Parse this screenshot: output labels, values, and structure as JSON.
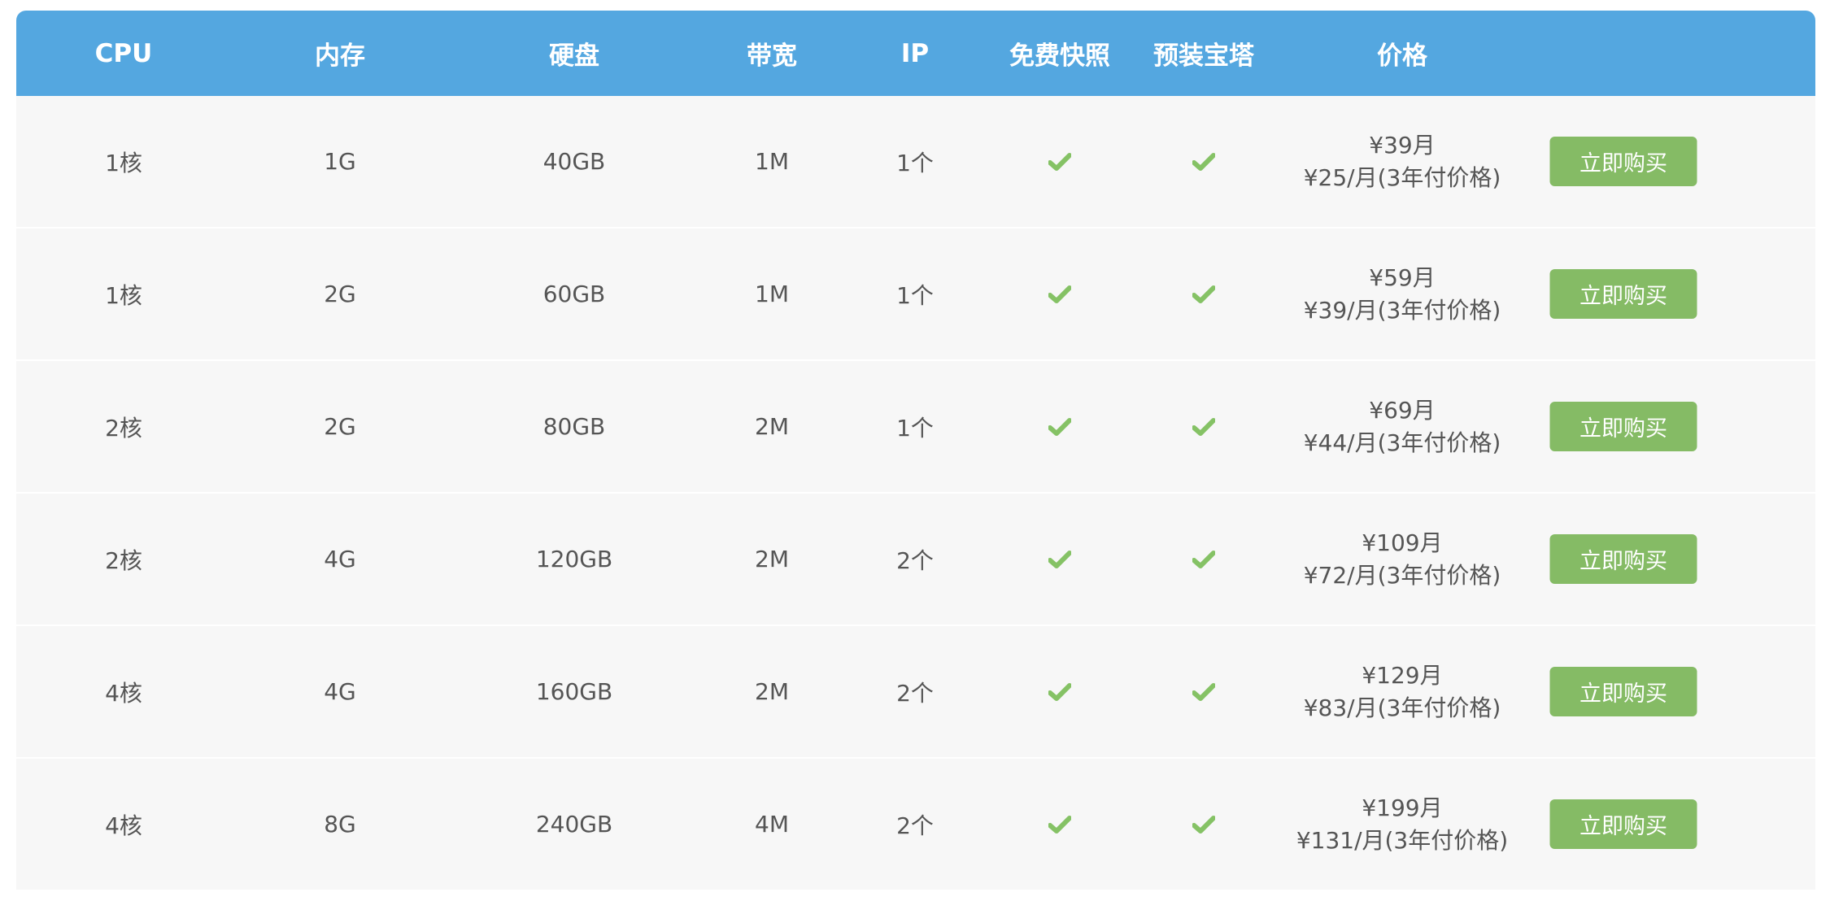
{
  "table": {
    "headers": {
      "cpu": "CPU",
      "memory": "内存",
      "disk": "硬盘",
      "bandwidth": "带宽",
      "ip": "IP",
      "snapshot": "免费快照",
      "baota": "预装宝塔",
      "price": "价格"
    },
    "rows": [
      {
        "cpu": "1核",
        "memory": "1G",
        "disk": "40GB",
        "bandwidth": "1M",
        "ip": "1个",
        "snapshot": true,
        "baota": true,
        "price_monthly": "¥39月",
        "price_3yr": "¥25/月(3年付价格)",
        "buy_label": "立即购买"
      },
      {
        "cpu": "1核",
        "memory": "2G",
        "disk": "60GB",
        "bandwidth": "1M",
        "ip": "1个",
        "snapshot": true,
        "baota": true,
        "price_monthly": "¥59月",
        "price_3yr": "¥39/月(3年付价格)",
        "buy_label": "立即购买"
      },
      {
        "cpu": "2核",
        "memory": "2G",
        "disk": "80GB",
        "bandwidth": "2M",
        "ip": "1个",
        "snapshot": true,
        "baota": true,
        "price_monthly": "¥69月",
        "price_3yr": "¥44/月(3年付价格)",
        "buy_label": "立即购买"
      },
      {
        "cpu": "2核",
        "memory": "4G",
        "disk": "120GB",
        "bandwidth": "2M",
        "ip": "2个",
        "snapshot": true,
        "baota": true,
        "price_monthly": "¥109月",
        "price_3yr": "¥72/月(3年付价格)",
        "buy_label": "立即购买"
      },
      {
        "cpu": "4核",
        "memory": "4G",
        "disk": "160GB",
        "bandwidth": "2M",
        "ip": "2个",
        "snapshot": true,
        "baota": true,
        "price_monthly": "¥129月",
        "price_3yr": "¥83/月(3年付价格)",
        "buy_label": "立即购买"
      },
      {
        "cpu": "4核",
        "memory": "8G",
        "disk": "240GB",
        "bandwidth": "4M",
        "ip": "2个",
        "snapshot": true,
        "baota": true,
        "price_monthly": "¥199月",
        "price_3yr": "¥131/月(3年付价格)",
        "buy_label": "立即购买"
      }
    ]
  },
  "colors": {
    "header_bg": "#54a7e0",
    "row_bg": "#f7f7f7",
    "check": "#85c265",
    "button": "#85bb65"
  },
  "icons": {
    "check": "check-icon"
  }
}
